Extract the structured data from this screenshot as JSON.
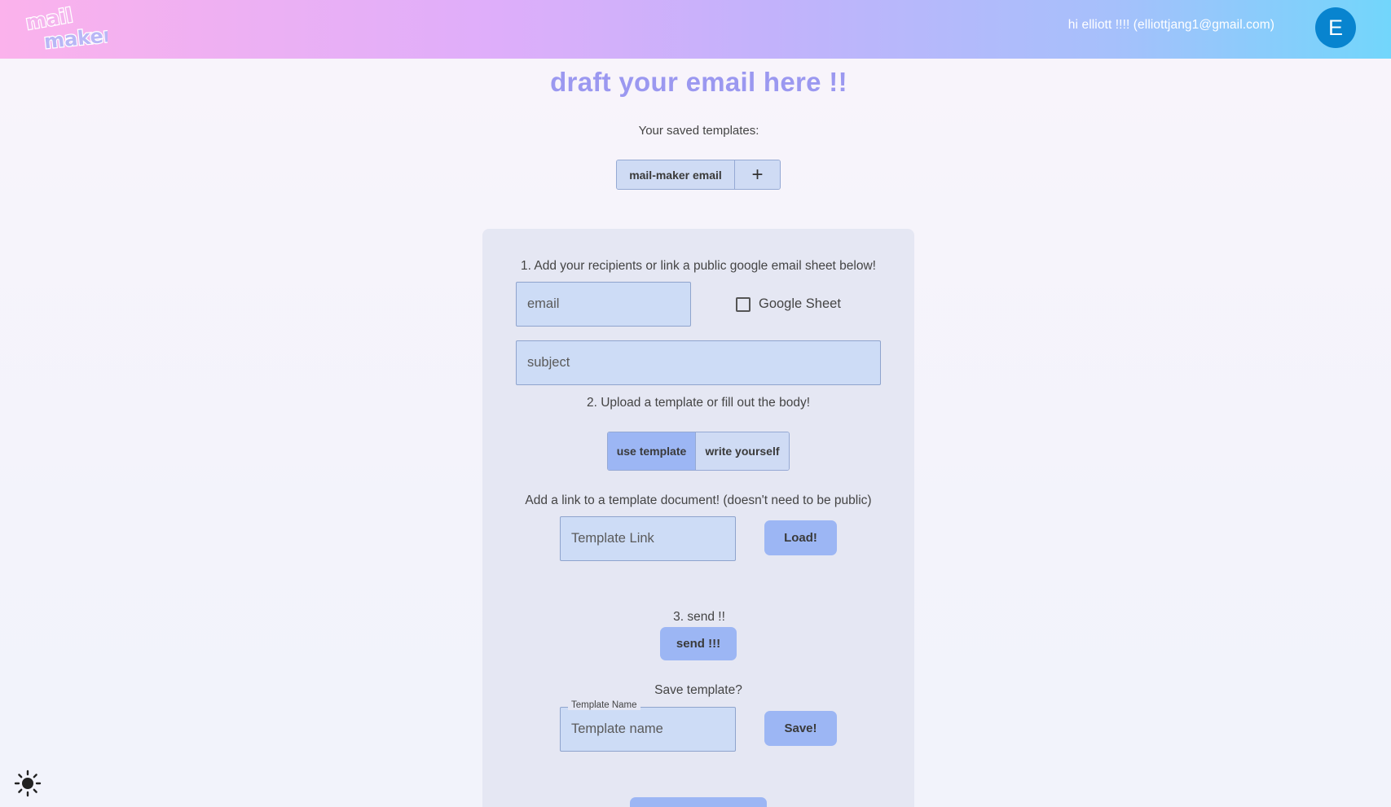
{
  "header": {
    "logo_text": "mail maker",
    "greeting": "hi elliott !!!! (elliottjang1@gmail.com)",
    "avatar_letter": "E"
  },
  "main": {
    "title": "draft your email here !!",
    "saved_templates_label": "Your saved templates:",
    "saved_templates": [
      "mail-maker email"
    ],
    "add_template_symbol": "+"
  },
  "form": {
    "step1_label": "1. Add your recipients or link a public google email sheet below!",
    "email_placeholder": "email",
    "google_sheet_label": "Google Sheet",
    "google_sheet_checked": false,
    "subject_placeholder": "subject",
    "step2_label": "2. Upload a template or fill out the body!",
    "mode_options": [
      "use template",
      "write yourself"
    ],
    "mode_selected": "use template",
    "template_link_label": "Add a link to a template document! (doesn't need to be public)",
    "template_link_placeholder": "Template Link",
    "load_button": "Load!",
    "step3_label": "3. send !!",
    "send_button": "send !!!",
    "save_template_label": "Save template?",
    "template_name_label": "Template Name",
    "template_name_placeholder": "Template name",
    "save_button": "Save!"
  },
  "theme": {
    "icon": "sun-icon",
    "accent": "#9cb6f4",
    "title_color": "#9b98f0",
    "avatar_color": "#0884cf"
  }
}
